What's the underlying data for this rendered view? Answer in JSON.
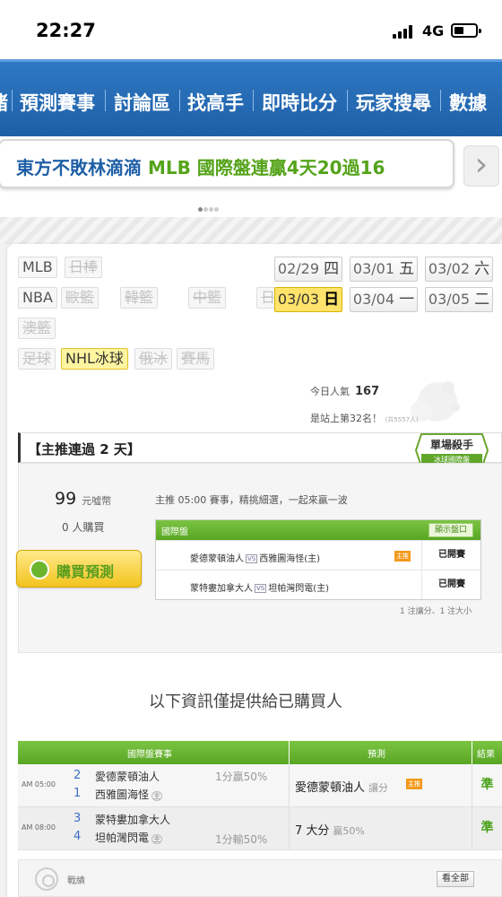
{
  "status": {
    "time": "22:27",
    "network": "4G"
  },
  "nav": {
    "items": [
      "賭",
      "預測賽事",
      "討論區",
      "找高手",
      "即時比分",
      "玩家搜尋",
      "數據"
    ]
  },
  "banner": {
    "name": "東方不敗林滴滴",
    "headline": "MLB 國際盤連贏4天20過16"
  },
  "sports": [
    {
      "label": "MLB",
      "state": "enabled"
    },
    {
      "label": "日棒",
      "state": "disabled"
    },
    {
      "label": "NBA",
      "state": "enabled"
    },
    {
      "label": "歐籃",
      "state": "disabled"
    },
    {
      "label": "韓籃",
      "state": "disabled"
    },
    {
      "label": "中籃",
      "state": "disabled"
    },
    {
      "label": "日籃",
      "state": "disabled"
    },
    {
      "label": "澳籃",
      "state": "disabled"
    },
    {
      "label": "足球",
      "state": "disabled"
    },
    {
      "label": "NHL冰球",
      "state": "active"
    },
    {
      "label": "俄冰",
      "state": "disabled"
    },
    {
      "label": "賽馬",
      "state": "disabled"
    }
  ],
  "dates": [
    {
      "date": "02/29",
      "day": "四",
      "active": false
    },
    {
      "date": "03/01",
      "day": "五",
      "active": false
    },
    {
      "date": "03/02",
      "day": "六",
      "active": false
    },
    {
      "date": "03/03",
      "day": "日",
      "active": true
    },
    {
      "date": "03/04",
      "day": "一",
      "active": false
    },
    {
      "date": "03/05",
      "day": "二",
      "active": false
    }
  ],
  "popularity": {
    "label": "今日人氣",
    "value": "167",
    "rank_text": "是站上第32名！",
    "rank_small": "(共5557人)"
  },
  "pick": {
    "header": "【主推連過 2 天】",
    "badge_title": "單場殺手",
    "badge_sub": "冰球國際盤",
    "price": "99",
    "price_unit": "元噓幣",
    "buyers": "0 人購買",
    "buy_label": "購買預測",
    "description": "主推 05:00 賽事，精挑細選，一起來贏一波",
    "table_title": "國際盤",
    "show_button": "顯示盤口",
    "games": [
      {
        "away": "愛德蒙頓油人",
        "home": "西雅圖海怪(主)",
        "tag": "主推",
        "status": "已開賽"
      },
      {
        "away": "蒙特婁加拿大人",
        "home": "坦帕灣閃電(主)",
        "tag": "",
        "status": "已開賽"
      }
    ],
    "vs": "VS",
    "note": "1 注讓分、1 注大小"
  },
  "info_text": "以下資訊僅提供給已購買人",
  "results": {
    "headers": [
      "國際盤賽事",
      "預測",
      "結果"
    ],
    "rows": [
      {
        "time": "AM 05:00",
        "n1": "2",
        "team1": "愛德蒙頓油人",
        "n2": "1",
        "team2": "西雅圖海怪",
        "home_mark": "主",
        "odds1": "1分贏50%",
        "odds2": "",
        "pred": "愛德蒙頓油人",
        "pred_small": "讓分",
        "pred_tag": "主推",
        "result": "準"
      },
      {
        "time": "AM 08:00",
        "n1": "3",
        "team1": "蒙特婁加拿大人",
        "n2": "4",
        "team2": "坦帕灣閃電",
        "home_mark": "主",
        "odds1": "",
        "odds2": "1分輸50%",
        "pred": "7 大分",
        "pred_small": "贏50%",
        "pred_tag": "",
        "result": "準"
      }
    ]
  },
  "record": {
    "label": "戰績",
    "all_button": "看全部"
  },
  "colors": {
    "nav": "#2e78c3",
    "green": "#58a623",
    "accent_yellow": "#ffe36a",
    "banner_green": "#55a31a"
  }
}
